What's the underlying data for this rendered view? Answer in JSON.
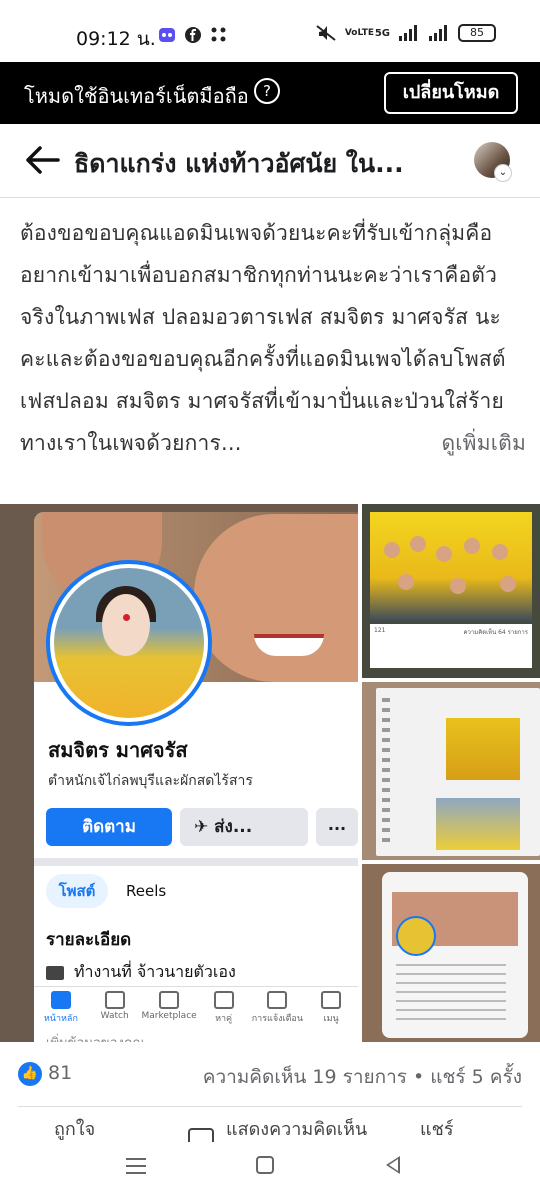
{
  "status_bar": {
    "time": "09:12 น.",
    "battery": "85",
    "net_label": "5G",
    "volte_label": "VoLTE"
  },
  "mode_banner": {
    "text": "โหมดใช้อินเทอร์เน็ตมือถือ",
    "help_icon": "?",
    "switch_button": "เปลี่ยนโหมด"
  },
  "header": {
    "title": "ธิดาแกร่ง แห่งท้าวอัศนัย ใน...",
    "avatar_chevron": "⌄"
  },
  "post": {
    "text": "ต้องขอขอบคุณแอดมินเพจด้วยนะคะที่รับเข้ากลุ่มคืออยากเข้ามาเพื่อบอกสมาชิกทุกท่านนะคะว่าเราคือตัวจริงในภาพเฟส ปลอมอวตารเฟส สมจิตร มาศจรัส นะคะและต้องขอขอบคุณอีกครั้งที่แอดมินเพจได้ลบโพสต์เฟสปลอม สมจิตร มาศจรัสที่เข้ามาปั่นและป่วนใส่ร้ายทางเราในเพจด้วยการ...",
    "see_more": "ดูเพิ่มเติม"
  },
  "photo_main": {
    "profile_name": "สมจิตร มาศจรัส",
    "profile_subtitle": "ตำหนักเจ้ไก่ลพบุรีและผักสดไร้สาร",
    "follow_button": "ติดตาม",
    "message_button": "ส่ง...",
    "more_button": "...",
    "tab_posts": "โพสต์",
    "tab_reels": "Reels",
    "details_heading": "รายละเอียด",
    "work_text": "ทำงานที่ จ้าวนายตัวเอง",
    "nav": [
      "หน้าหลัก",
      "Watch",
      "Marketplace",
      "หาคู่",
      "การแจ้งเตือน",
      "เมนู"
    ],
    "below_nav": "เพิ่มข้อมูลของคุณ"
  },
  "photo_r1": {
    "likes_small": "121",
    "comments_small": "ความคิดเห็น 64 รายการ"
  },
  "reactions": {
    "like_icon": "👍",
    "like_count": "81",
    "meta": "ความคิดเห็น 19 รายการ • แชร์ 5 ครั้ง"
  },
  "actions": {
    "like": "ถูกใจ",
    "comment": "แสดงความคิดเห็น",
    "share": "แชร์"
  },
  "colors": {
    "brand": "#1877f2",
    "banner_bg": "#000000",
    "text_secondary": "#65676b"
  }
}
